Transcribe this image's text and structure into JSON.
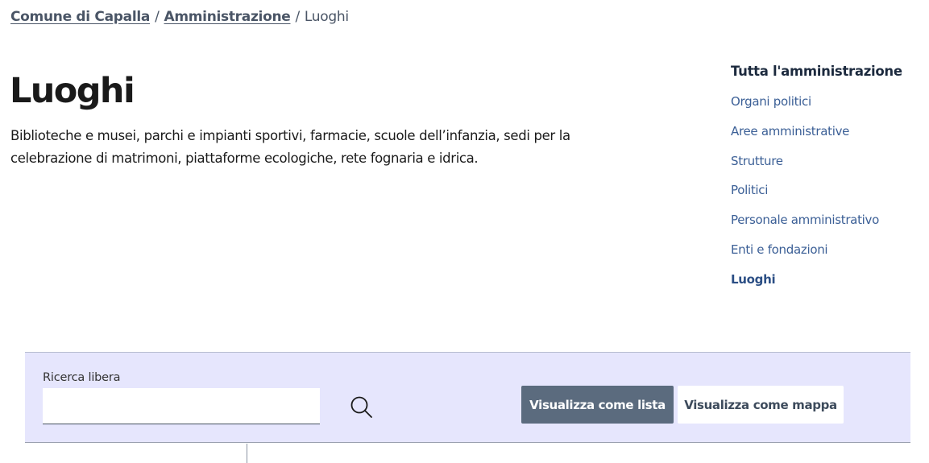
{
  "breadcrumb": {
    "items": [
      "Comune di Capalla",
      "Amministrazione"
    ],
    "separator": "/",
    "current": "Luoghi"
  },
  "page": {
    "title": "Luoghi",
    "description": "Biblioteche e musei, parchi e impianti sportivi, farmacie, scuole dell’infanzia, sedi per la celebrazione di matrimoni, piattaforme ecologiche, rete fognaria e idrica."
  },
  "side_nav": {
    "title": "Tutta l'amministrazione",
    "items": [
      {
        "label": "Organi politici"
      },
      {
        "label": "Aree amministrative"
      },
      {
        "label": "Strutture"
      },
      {
        "label": "Politici"
      },
      {
        "label": "Personale amministrativo"
      },
      {
        "label": "Enti e fondazioni"
      },
      {
        "label": "Luoghi",
        "active": true
      }
    ]
  },
  "search": {
    "label": "Ricerca libera",
    "value": "",
    "placeholder": "",
    "icon": "search-icon"
  },
  "view_toggle": {
    "list_label": "Visualizza come lista",
    "map_label": "Visualizza come mappa",
    "selected": "list"
  },
  "colors": {
    "link": "#3b5f96",
    "panel_bg": "#e6e6fd",
    "active_button": "#5b6b7e",
    "text": "#1a1a1a"
  }
}
